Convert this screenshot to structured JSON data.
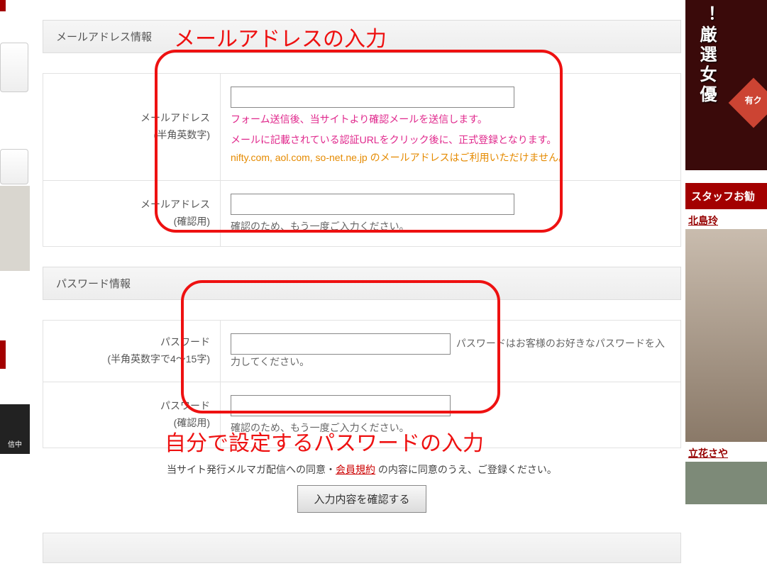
{
  "annotations": {
    "top_label": "メールアドレスの入力",
    "bottom_label": "自分で設定するパスワードの入力"
  },
  "sections": {
    "email": {
      "heading": "メールアドレス情報",
      "row1": {
        "label_l1": "メールアドレス",
        "label_l2": "(半角英数字)",
        "hint_pink_l1": "フォーム送信後、当サイトより確認メールを送信します。",
        "hint_pink_l2": "メールに記載されている認証URLをクリック後に、正式登録となります。",
        "hint_orange": "nifty.com, aol.com, so-net.ne.jp のメールアドレスはご利用いただけません。"
      },
      "row2": {
        "label_l1": "メールアドレス",
        "label_l2": "(確認用)",
        "hint": "確認のため、もう一度ご入力ください。"
      }
    },
    "password": {
      "heading": "パスワード情報",
      "row1": {
        "label_l1": "パスワード",
        "label_l2": "(半角英数字で4～15字)",
        "hint": "パスワードはお客様のお好きなパスワードを入力してください。"
      },
      "row2": {
        "label_l1": "パスワード",
        "label_l2": "(確認用)",
        "hint": "確認のため、もう一度ご入力ください。"
      }
    }
  },
  "consent": {
    "prefix": "当サイト発行メルマガ配信への同意・",
    "link": "会員規約",
    "suffix": " の内容に同意のうえ、ご登録ください。"
  },
  "submit_label": "入力内容を確認する",
  "sidebar": {
    "banner_text": "！厳選女優",
    "banner_ribbon": "有ク",
    "staff_heading": "スタッフお勧",
    "name1": "北島玲",
    "name2": "立花さや"
  },
  "left": {
    "badge": "信中"
  }
}
